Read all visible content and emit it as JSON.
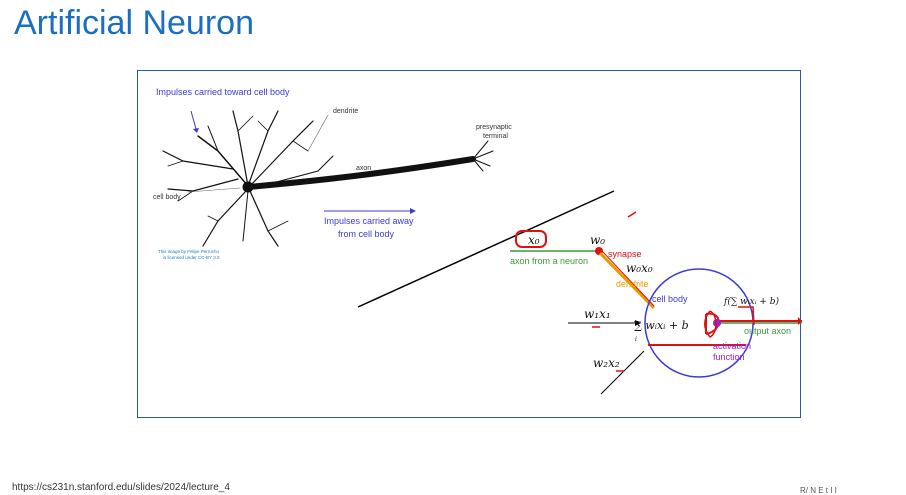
{
  "slide": {
    "title": "Artificial Neuron",
    "footer_url": "https://cs231n.stanford.edu/slides/2024/lecture_4",
    "footer_right_cut": "R/ N E t  I   I"
  },
  "bio": {
    "impulses_toward": "Impulses carried toward cell body",
    "dendrite": "dendrite",
    "presynaptic_1": "presynaptic",
    "presynaptic_2": "terminal",
    "axon": "axon",
    "cell_body": "cell body",
    "impulses_away_1": "Impulses carried away",
    "impulses_away_2": "from cell body",
    "credit_1": "This image by Felipe Perrucho",
    "credit_2": "is licensed under CC-BY 3.0"
  },
  "model": {
    "x0": "x₀",
    "w0": "w₀",
    "synapse": "synapse",
    "axon_from_neuron": "axon from a neuron",
    "w0x0": "w₀x₀",
    "dendrite": "dendrite",
    "cell_body": "cell body",
    "w1x1": "w₁x₁",
    "w2x2": "w₂x₂",
    "sum_expr": "∑ wᵢxᵢ + b",
    "sum_index": "i",
    "f_expr": "f(∑ wᵢxᵢ + b)",
    "output_axon": "output axon",
    "activation_1": "activation",
    "activation_2": "function"
  },
  "colors": {
    "title": "#1a6fc2",
    "bio_label": "#3b3bd6",
    "green": "#3a9a3a",
    "red": "#e01010",
    "orange": "#e69b00",
    "purple": "#9b1fd6",
    "blue": "#3b3bd6"
  }
}
